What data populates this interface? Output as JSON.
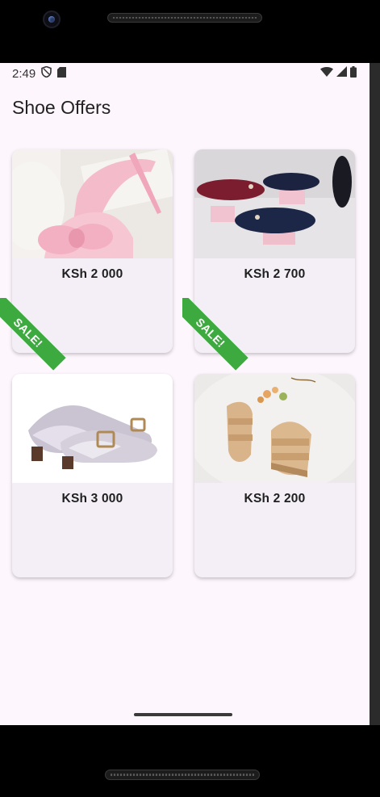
{
  "status_bar": {
    "time": "2:49",
    "icons": [
      "shield-icon",
      "sd-card-icon",
      "wifi-icon",
      "signal-icon",
      "battery-icon"
    ]
  },
  "app": {
    "title": "Shoe Offers"
  },
  "products": [
    {
      "price": "KSh 2 000",
      "on_sale": true,
      "sale_label": "SALE!",
      "image": "pink-bow-heels"
    },
    {
      "price": "KSh 2 700",
      "on_sale": true,
      "sale_label": "SALE!",
      "image": "flat-shoes-on-pink-blocks"
    },
    {
      "price": "KSh 3 000",
      "on_sale": false,
      "image": "lilac-buckle-flats"
    },
    {
      "price": "KSh 2 200",
      "on_sale": false,
      "image": "beige-strap-sandals"
    }
  ],
  "colors": {
    "background": "#fdf6fd",
    "card": "#f4eff6",
    "sale_ribbon": "#3daa3f"
  }
}
